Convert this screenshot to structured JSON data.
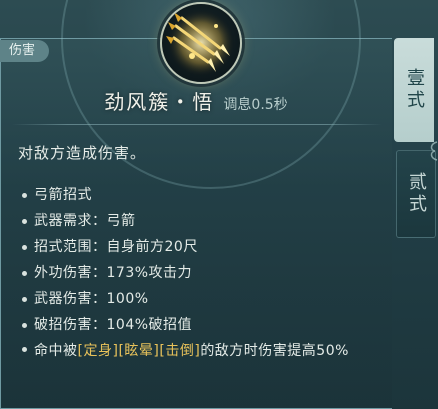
{
  "tag": "伤害",
  "skill": {
    "icon": "golden-arrows-icon",
    "name": "劲风簇・悟",
    "cooldown": "调息0.5秒",
    "description": "对敌方造成伤害。"
  },
  "stats": [
    "弓箭招式",
    "武器需求：弓箭",
    "招式范围：自身前方20尺",
    "外功伤害：173%攻击力",
    "武器伤害：100%",
    "破招伤害：104%破招值"
  ],
  "effect": {
    "prefix": "命中被",
    "status_1": "[定身]",
    "status_2": "[眩晕]",
    "status_3": "[击倒]",
    "suffix": "的敌方时伤害提高50%"
  },
  "tabs": [
    {
      "label": "壹式",
      "active": true
    },
    {
      "label": "贰式",
      "active": false
    }
  ],
  "colors": {
    "highlight": "#e8c25a",
    "text": "#e4ebe7",
    "active_tab": "#c9dcda"
  }
}
